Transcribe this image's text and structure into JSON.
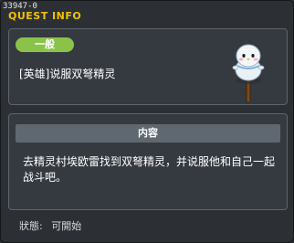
{
  "quest_id": "33947-0",
  "window_title": "QUEST INFO",
  "quest": {
    "category": "一般",
    "name": "[英雄]说服双弩精灵",
    "npc_icon": "snowman-on-stick-icon"
  },
  "content": {
    "header": "内容",
    "text": "去精灵村埃欧雷找到双弩精灵，并说服他和自己一起战斗吧。"
  },
  "status": {
    "label": "狀態:",
    "value": "可開始"
  },
  "colors": {
    "title": "#f2c200",
    "badge": "#8bc34a"
  }
}
